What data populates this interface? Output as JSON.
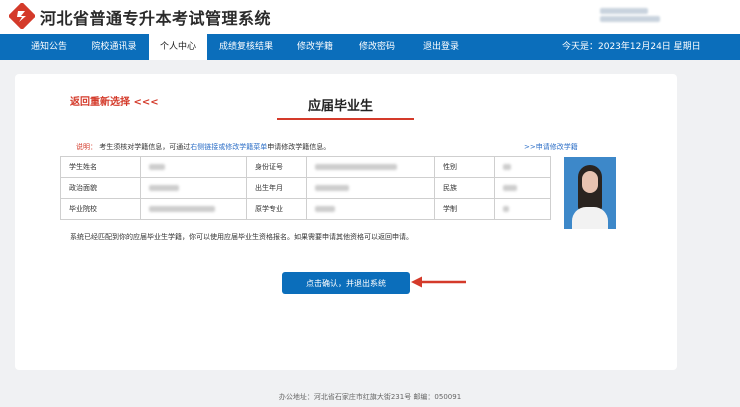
{
  "header": {
    "title": "河北省普通专升本考试管理系统"
  },
  "nav": {
    "items": [
      {
        "label": "通知公告"
      },
      {
        "label": "院校通讯录"
      },
      {
        "label": "个人中心"
      },
      {
        "label": "成绩复核结果"
      },
      {
        "label": "修改学籍"
      },
      {
        "label": "修改密码"
      },
      {
        "label": "退出登录"
      }
    ],
    "today": "今天是：2023年12月24日 星期日"
  },
  "main": {
    "back_link": "返回重新选择 <<<",
    "heading": "应届毕业生",
    "note_label": "说明：",
    "note_text": "考生须核对学籍信息，可通过",
    "note_link": "右侧链接或修改学籍菜单",
    "note_tail": "申请修改学籍信息。",
    "apply_link": ">>申请修改学籍",
    "table": {
      "labels": [
        "学生姓名",
        "身份证号",
        "性别",
        "政治面貌",
        "出生年月",
        "民族",
        "毕业院校",
        "原学专业",
        "学制"
      ]
    },
    "match_text": "系统已经匹配到你的应届毕业生学籍，你可以使用应届毕业生资格报名。如果需要申请其他资格可以返回申请。",
    "confirm_button": "点击确认，并退出系统"
  },
  "footer": {
    "text": "办公地址：河北省石家庄市红旗大街231号   邮编：050091"
  },
  "colors": {
    "nav_bg": "#0b6ebb",
    "accent_red": "#d43a2a",
    "link_blue": "#2d6fc7"
  }
}
